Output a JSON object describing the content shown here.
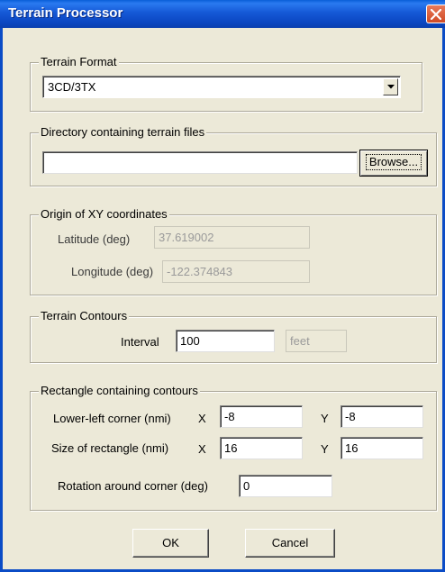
{
  "window": {
    "title": "Terrain Processor"
  },
  "format_group": {
    "legend": "Terrain Format",
    "selected": "3CD/3TX"
  },
  "directory_group": {
    "legend": "Directory containing terrain files",
    "path_value": "",
    "browse_label": "Browse..."
  },
  "origin_group": {
    "legend": "Origin of XY coordinates",
    "latitude_label": "Latitude (deg)",
    "latitude_value": "37.619002",
    "longitude_label": "Longitude (deg)",
    "longitude_value": "-122.374843"
  },
  "contours_group": {
    "legend": "Terrain Contours",
    "interval_label": "Interval",
    "interval_value": "100",
    "units_value": "feet"
  },
  "rectangle_group": {
    "legend": "Rectangle containing contours",
    "lower_left_label": "Lower-left corner (nmi)",
    "lower_left_x_label": "X",
    "lower_left_x": "-8",
    "lower_left_y_label": "Y",
    "lower_left_y": "-8",
    "size_label": "Size of rectangle (nmi)",
    "size_x_label": "X",
    "size_x": "16",
    "size_y_label": "Y",
    "size_y": "16",
    "rotation_label": "Rotation around corner (deg)",
    "rotation_value": "0"
  },
  "buttons": {
    "ok": "OK",
    "cancel": "Cancel"
  }
}
